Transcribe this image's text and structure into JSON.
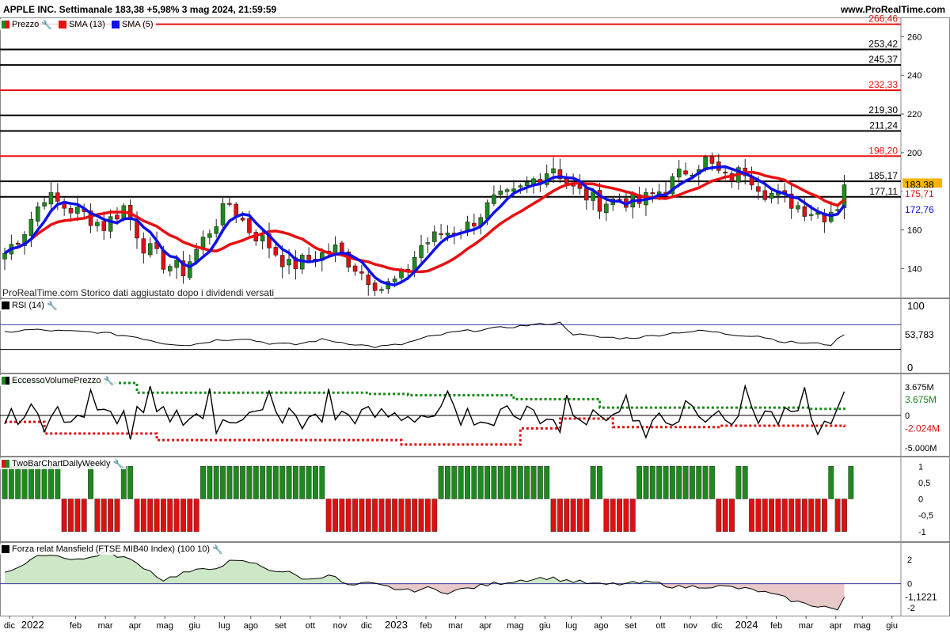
{
  "header": {
    "title": "APPLE INC. Settimanale 183,38 +5,98% 3 mag 2024, 21:59:59",
    "site": "www.ProRealTime.com"
  },
  "watermark": "ProRealTime.com  Storico dati aggiustato dopo i dividendi versati",
  "legend": {
    "price": "Prezzo",
    "sma13": "SMA (13)",
    "sma5": "SMA (5)",
    "rsi": "RSI (14)",
    "evp": "EccessoVolumePrezzo",
    "twobar": "TwoBarChartDailyWeekly",
    "mansfield": "Forza relat Mansfield (FTSE MIB40 Index) (100 10)"
  },
  "colors": {
    "bull": "#1e8a1e",
    "bear": "#e01010",
    "sma13": "#e81010",
    "sma5": "#1010e8",
    "resistance_red": "#e81010",
    "resistance_black": "#000000"
  },
  "chart_data": [
    {
      "type": "candlestick",
      "title": "APPLE INC. Settimanale",
      "period": "weekly",
      "x_range": [
        "2021-11-22",
        "2024-07-01"
      ],
      "x_tick_labels": [
        "dic",
        "2022",
        "feb",
        "mar",
        "apr",
        "mag",
        "giu",
        "lug",
        "ago",
        "set",
        "ott",
        "nov",
        "dic",
        "2023",
        "feb",
        "mar",
        "apr",
        "mag",
        "giu",
        "lug",
        "ago",
        "set",
        "ott",
        "nov",
        "dic",
        "2024",
        "feb",
        "mar",
        "apr",
        "mag",
        "giu"
      ],
      "y_ticks": [
        140,
        160,
        180,
        200,
        220,
        240,
        260
      ],
      "ylim": [
        125,
        270
      ],
      "last_close": "183,38",
      "sma13_last": "175,71",
      "sma5_last": "172,76",
      "horizontal_levels": [
        {
          "value": 266.46,
          "label": "266,46",
          "color": "red"
        },
        {
          "value": 253.42,
          "label": "253,42",
          "color": "black"
        },
        {
          "value": 245.37,
          "label": "245,37",
          "color": "black"
        },
        {
          "value": 232.33,
          "label": "232,33",
          "color": "red"
        },
        {
          "value": 219.3,
          "label": "219,30",
          "color": "black"
        },
        {
          "value": 211.24,
          "label": "211,24",
          "color": "black"
        },
        {
          "value": 198.2,
          "label": "198,20",
          "color": "red"
        },
        {
          "value": 185.17,
          "label": "185,17",
          "color": "black"
        },
        {
          "value": 177.11,
          "label": "177,11",
          "color": "black"
        }
      ],
      "close_anchors": [
        [
          0,
          148
        ],
        [
          3,
          160
        ],
        [
          6,
          178
        ],
        [
          9,
          172
        ],
        [
          12,
          168
        ],
        [
          15,
          162
        ],
        [
          18,
          172
        ],
        [
          21,
          152
        ],
        [
          24,
          143
        ],
        [
          27,
          139
        ],
        [
          31,
          160
        ],
        [
          34,
          174
        ],
        [
          37,
          160
        ],
        [
          40,
          152
        ],
        [
          43,
          141
        ],
        [
          47,
          146
        ],
        [
          50,
          150
        ],
        [
          54,
          138
        ],
        [
          57,
          130
        ],
        [
          60,
          135
        ],
        [
          63,
          152
        ],
        [
          66,
          158
        ],
        [
          70,
          162
        ],
        [
          74,
          175
        ],
        [
          77,
          178
        ],
        [
          80,
          186
        ],
        [
          83,
          193
        ],
        [
          86,
          181
        ],
        [
          90,
          174
        ],
        [
          93,
          176
        ],
        [
          96,
          174
        ],
        [
          100,
          182
        ],
        [
          103,
          191
        ],
        [
          106,
          196
        ],
        [
          109,
          186
        ],
        [
          112,
          191
        ],
        [
          115,
          180
        ],
        [
          118,
          176
        ],
        [
          121,
          171
        ],
        [
          124,
          168
        ],
        [
          126,
          173
        ],
        [
          127,
          183.38
        ]
      ]
    },
    {
      "type": "line",
      "title": "RSI (14)",
      "ylim": [
        0,
        100
      ],
      "y_ticks": [
        0,
        100
      ],
      "bands": [
        30,
        70
      ],
      "last_value": "53,783",
      "anchors": [
        [
          0,
          58
        ],
        [
          4,
          62
        ],
        [
          8,
          60
        ],
        [
          14,
          58
        ],
        [
          20,
          50
        ],
        [
          24,
          40
        ],
        [
          28,
          37
        ],
        [
          32,
          45
        ],
        [
          36,
          48
        ],
        [
          40,
          40
        ],
        [
          44,
          38
        ],
        [
          48,
          46
        ],
        [
          52,
          40
        ],
        [
          56,
          34
        ],
        [
          60,
          38
        ],
        [
          64,
          50
        ],
        [
          68,
          58
        ],
        [
          72,
          62
        ],
        [
          76,
          66
        ],
        [
          80,
          70
        ],
        [
          84,
          73
        ],
        [
          86,
          55
        ],
        [
          90,
          50
        ],
        [
          94,
          48
        ],
        [
          98,
          52
        ],
        [
          102,
          58
        ],
        [
          106,
          60
        ],
        [
          110,
          54
        ],
        [
          114,
          52
        ],
        [
          118,
          42
        ],
        [
          122,
          40
        ],
        [
          125,
          38
        ],
        [
          127,
          53.783
        ]
      ]
    },
    {
      "type": "line",
      "title": "EccessoVolumePrezzo",
      "y_ticks_labels": [
        "3.675M",
        "0",
        "-5.000M"
      ],
      "ylim": [
        -5.5,
        5
      ],
      "upper_value": "3.675M",
      "lower_value": "-2.024M",
      "last_value": 3.675,
      "upper_band_steps": [
        [
          0,
          5.0
        ],
        [
          10,
          5.0
        ],
        [
          15,
          5.0
        ],
        [
          20,
          3.5
        ],
        [
          50,
          3.5
        ],
        [
          55,
          3.3
        ],
        [
          61,
          3.1
        ],
        [
          73,
          3.1
        ],
        [
          77,
          2.5
        ],
        [
          90,
          1.2
        ],
        [
          106,
          1.2
        ],
        [
          118,
          1.2
        ],
        [
          122,
          1.0
        ],
        [
          127,
          1.2
        ]
      ],
      "lower_band_steps": [
        [
          0,
          -1.0
        ],
        [
          6,
          -2.8
        ],
        [
          14,
          -2.8
        ],
        [
          23,
          -3.8
        ],
        [
          52,
          -3.8
        ],
        [
          60,
          -4.5
        ],
        [
          75,
          -4.5
        ],
        [
          78,
          -2.0
        ],
        [
          84,
          -0.5
        ],
        [
          86,
          -0.5
        ],
        [
          92,
          -1.8
        ],
        [
          108,
          -1.6
        ],
        [
          118,
          -1.6
        ],
        [
          127,
          -1.8
        ]
      ]
    },
    {
      "type": "bar",
      "title": "TwoBarChartDailyWeekly",
      "y_ticks_labels": [
        "1",
        "0,5",
        "0",
        "-0,5",
        "-1"
      ],
      "ylim": [
        -1.2,
        1.2
      ],
      "values": [
        1,
        1,
        1,
        1,
        1,
        1,
        1,
        1,
        1,
        -1,
        -1,
        -1,
        -1,
        1,
        -1,
        -1,
        -1,
        -1,
        1,
        1,
        -1,
        -1,
        -1,
        -1,
        -1,
        -1,
        -1,
        -1,
        -1,
        -1,
        1,
        1,
        1,
        1,
        1,
        1,
        1,
        1,
        1,
        1,
        1,
        1,
        1,
        1,
        1,
        1,
        1,
        1,
        1,
        -1,
        -1,
        -1,
        -1,
        -1,
        -1,
        -1,
        -1,
        -1,
        -1,
        -1,
        -1,
        -1,
        -1,
        -1,
        -1,
        -1,
        1,
        1,
        1,
        1,
        1,
        1,
        1,
        1,
        1,
        1,
        1,
        1,
        1,
        1,
        1,
        1,
        1,
        -1,
        -1,
        -1,
        -1,
        -1,
        -1,
        1,
        1,
        -1,
        -1,
        -1,
        -1,
        -1,
        1,
        1,
        1,
        1,
        1,
        1,
        1,
        1,
        1,
        1,
        1,
        1,
        -1,
        -1,
        -1,
        1,
        1,
        -1,
        -1,
        -1,
        -1,
        -1,
        -1,
        -1,
        -1,
        -1,
        -1,
        -1,
        -1,
        1,
        -1,
        -1,
        1
      ]
    },
    {
      "type": "area",
      "title": "Forza relat Mansfield (FTSE MIB40 Index) (100 10)",
      "y_ticks_labels": [
        "2",
        "0",
        "-2"
      ],
      "ylim": [
        -2.4,
        3.2
      ],
      "last_value": "-1,1221",
      "anchors": [
        [
          0,
          1.0
        ],
        [
          3,
          1.6
        ],
        [
          6,
          2.5
        ],
        [
          9,
          2.2
        ],
        [
          12,
          2.0
        ],
        [
          15,
          2.6
        ],
        [
          18,
          2.2
        ],
        [
          21,
          1.4
        ],
        [
          24,
          0.3
        ],
        [
          27,
          0.9
        ],
        [
          31,
          1.2
        ],
        [
          34,
          1.8
        ],
        [
          37,
          1.8
        ],
        [
          40,
          1.2
        ],
        [
          43,
          0.9
        ],
        [
          46,
          0.3
        ],
        [
          49,
          0.8
        ],
        [
          52,
          -0.2
        ],
        [
          55,
          0.0
        ],
        [
          58,
          -0.3
        ],
        [
          61,
          -0.6
        ],
        [
          64,
          -0.4
        ],
        [
          67,
          -0.7
        ],
        [
          70,
          -0.4
        ],
        [
          74,
          0.0
        ],
        [
          78,
          0.3
        ],
        [
          82,
          0.5
        ],
        [
          86,
          0.2
        ],
        [
          90,
          -0.1
        ],
        [
          94,
          0.0
        ],
        [
          98,
          0.1
        ],
        [
          102,
          -0.3
        ],
        [
          106,
          -0.2
        ],
        [
          110,
          -0.3
        ],
        [
          114,
          -0.6
        ],
        [
          118,
          -1.2
        ],
        [
          121,
          -1.7
        ],
        [
          124,
          -1.9
        ],
        [
          126,
          -2.2
        ],
        [
          127,
          -1.1221
        ]
      ]
    }
  ]
}
